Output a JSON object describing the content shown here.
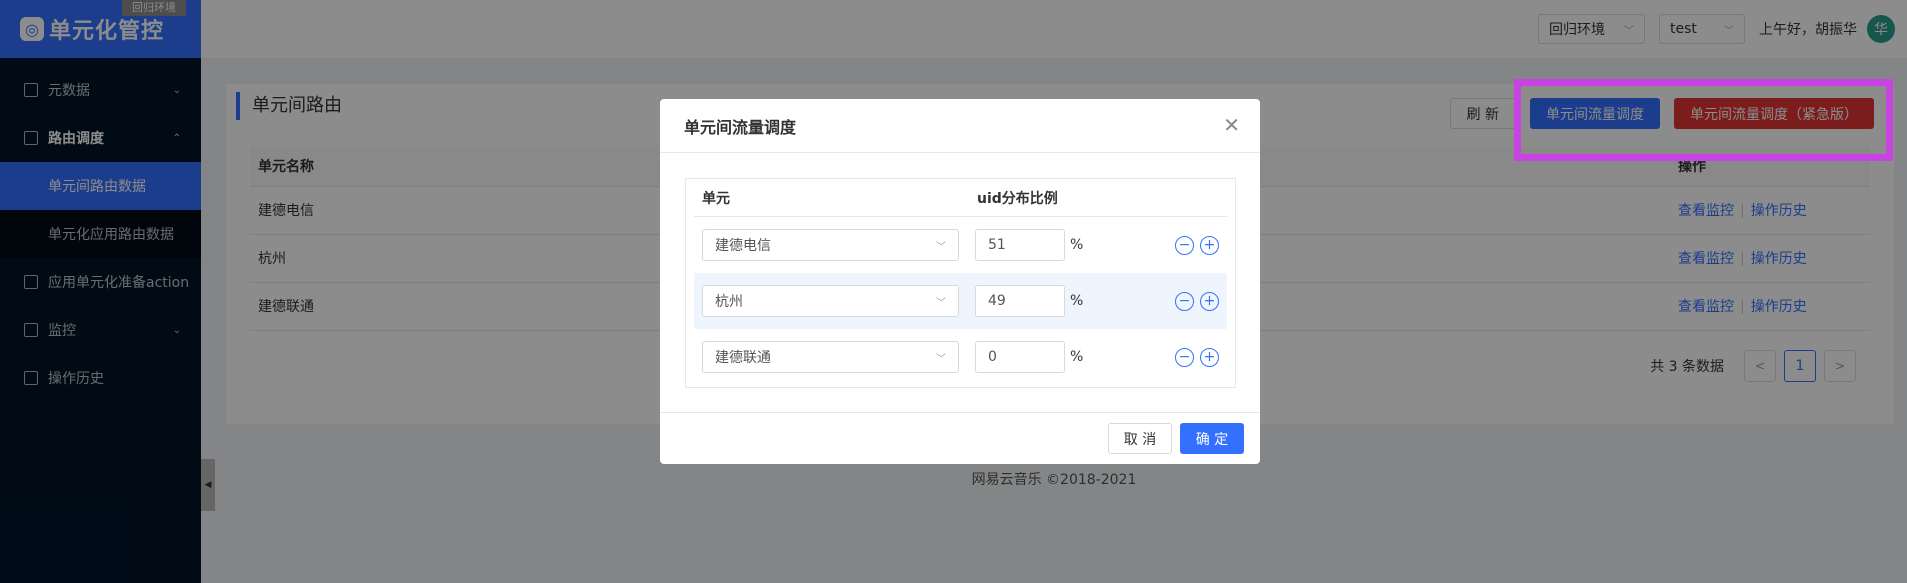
{
  "env_tag": "回归环境",
  "logo": {
    "text": "单元化管控"
  },
  "sidebar": {
    "items": [
      {
        "label": "元数据",
        "arrow": "⌄"
      },
      {
        "label": "路由调度",
        "arrow": "⌃"
      },
      {
        "label": "单元间路由数据"
      },
      {
        "label": "单元化应用路由数据"
      },
      {
        "label": "应用单元化准备action"
      },
      {
        "label": "监控",
        "arrow": "⌄"
      },
      {
        "label": "操作历史"
      }
    ]
  },
  "header": {
    "env_select": "回归环境",
    "user_select": "test",
    "greeting": "上午好，胡振华",
    "avatar_char": "华"
  },
  "page": {
    "title": "单元间路由",
    "refresh": "刷 新",
    "traffic_btn": "单元间流量调度",
    "emergency_btn": "单元间流量调度（紧急版）",
    "columns": [
      "单元名称",
      "操作"
    ],
    "rows": [
      {
        "name": "建德电信",
        "monitor": "查看监控",
        "history": "操作历史"
      },
      {
        "name": "杭州",
        "monitor": "查看监控",
        "history": "操作历史"
      },
      {
        "name": "建德联通",
        "monitor": "查看监控",
        "history": "操作历史"
      }
    ],
    "pagination": {
      "total": "共 3 条数据",
      "current": "1"
    }
  },
  "footer": "网易云音乐 ©2018-2021",
  "modal": {
    "title": "单元间流量调度",
    "col_unit": "单元",
    "col_ratio": "uid分布比例",
    "rows": [
      {
        "unit": "建德电信",
        "ratio": "51",
        "pct": "%"
      },
      {
        "unit": "杭州",
        "ratio": "49",
        "pct": "%"
      },
      {
        "unit": "建德联通",
        "ratio": "0",
        "pct": "%"
      }
    ],
    "cancel": "取 消",
    "ok": "确 定"
  }
}
